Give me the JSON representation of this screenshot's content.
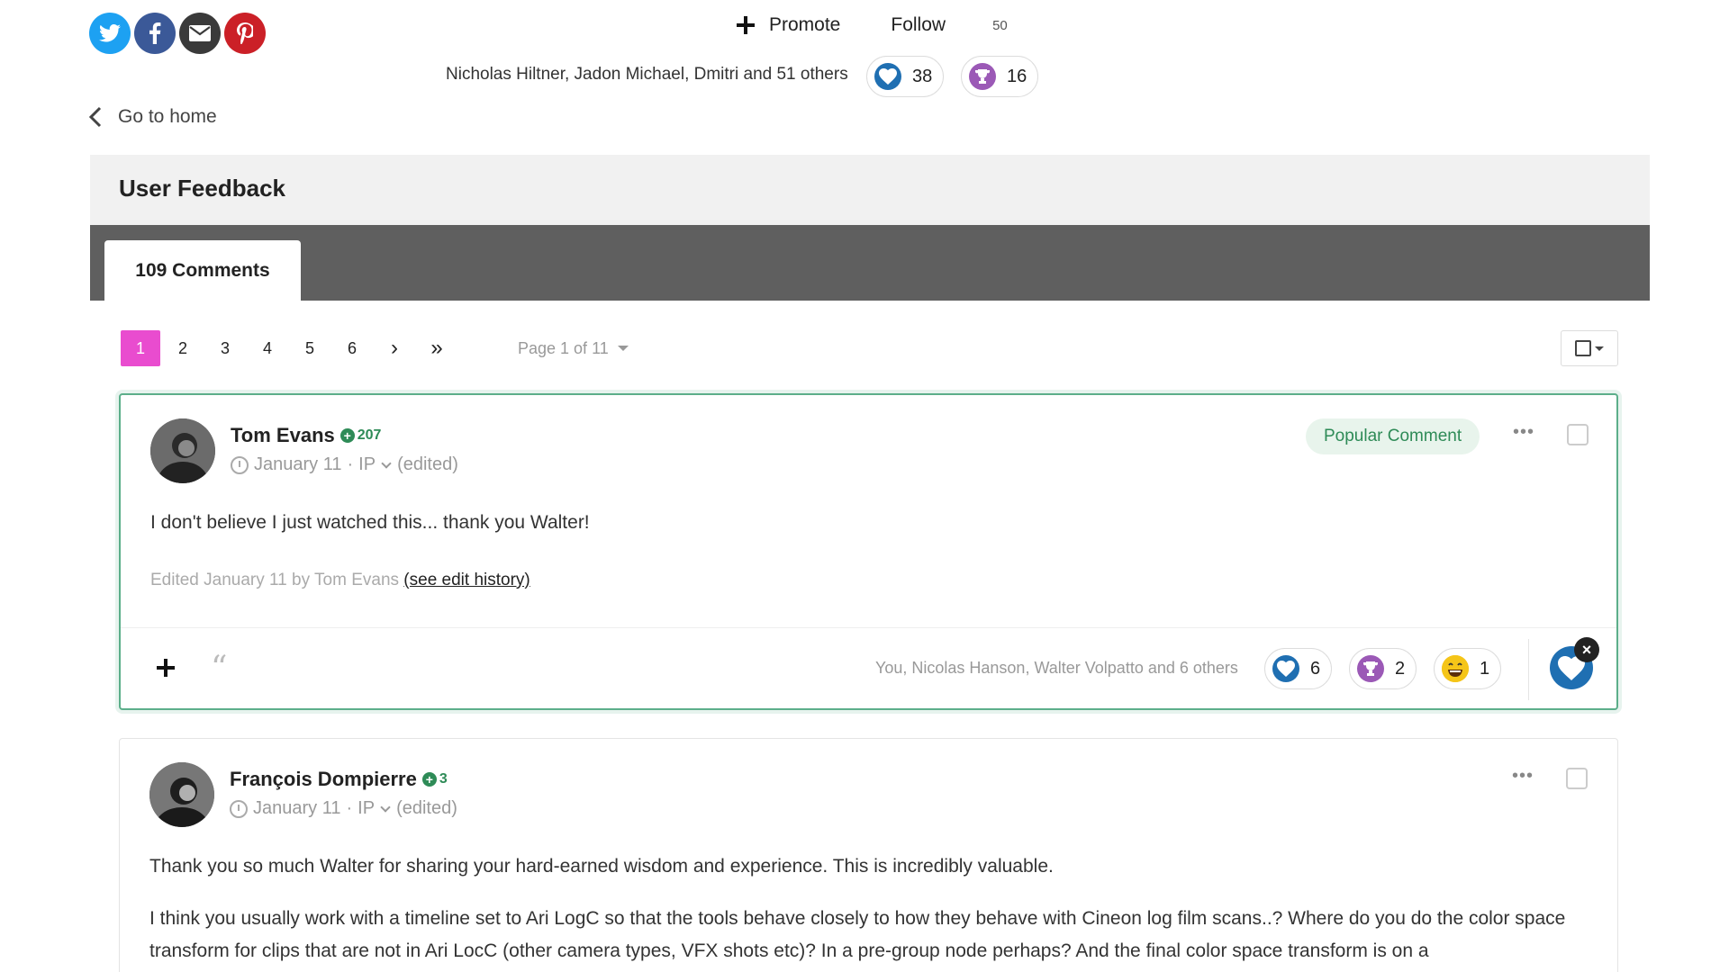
{
  "social": {
    "icons": [
      "twitter-icon",
      "facebook-icon",
      "email-icon",
      "pinterest-icon"
    ],
    "colors": {
      "twitter": "#1da1f2",
      "facebook": "#3b5998",
      "email": "#3a3a3a",
      "pinterest": "#cb2027"
    }
  },
  "topbar": {
    "promote_label": "Promote",
    "follow_label": "Follow",
    "follow_count": "50",
    "reactors_text": "Nicholas Hiltner, Jadon Michael, Dmitri and 51 others",
    "likes": "38",
    "trophies": "16"
  },
  "nav": {
    "go_home_label": "Go to home"
  },
  "header": {
    "title": "User Feedback"
  },
  "tabs": {
    "active_label": "109 Comments"
  },
  "pagination": {
    "pages": [
      "1",
      "2",
      "3",
      "4",
      "5",
      "6"
    ],
    "next": "›",
    "last": "»",
    "page_of": "Page 1 of 11",
    "active_color": "#e94ccf"
  },
  "comments": [
    {
      "author": "Tom Evans",
      "reputation": "207",
      "date": "January 11",
      "ip": "IP",
      "edited": "(edited)",
      "badge": "Popular Comment",
      "more": "•••",
      "body": "I don't believe I just watched this... thank you Walter!",
      "edit_note": "Edited January 11 by Tom Evans",
      "edit_link": "(see edit history)",
      "reactors": "You, Nicolas Hanson, Walter Volpatto and 6 others",
      "reactions": {
        "like": "6",
        "trophy": "2",
        "haha": "1"
      }
    },
    {
      "author": "François Dompierre",
      "reputation": "3",
      "date": "January 11",
      "ip": "IP",
      "edited": "(edited)",
      "more": "•••",
      "body_p1": "Thank you so much Walter for sharing your hard-earned wisdom and experience. This is incredibly valuable.",
      "body_p2": "I think you usually work with a timeline set to Ari LogC so that the tools behave closely to how they behave with Cineon log film scans..?  Where do you do the color space transform for clips that are not in Ari LocC (other camera types, VFX shots etc)? In a pre-group node perhaps? And the final color space transform is on a"
    }
  ],
  "colors": {
    "accent_green": "#2e8b57",
    "heart_blue": "#1f6fb2",
    "trophy_purple": "#9b59b6",
    "tab_bar": "#5f5f5f"
  }
}
